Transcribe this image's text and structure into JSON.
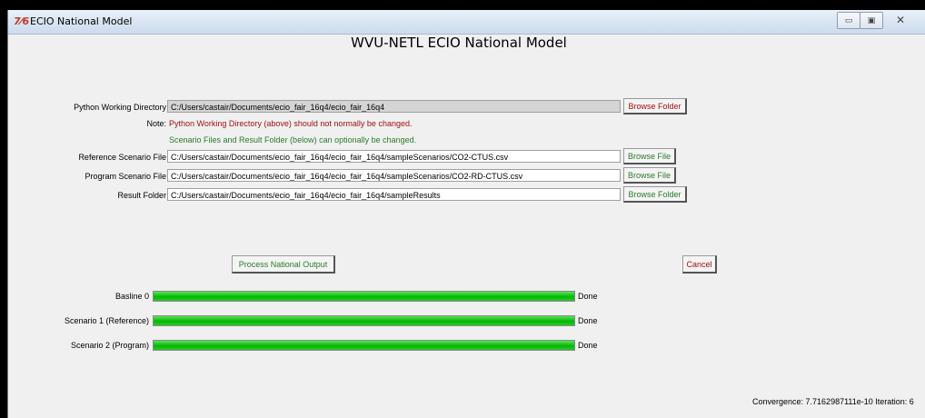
{
  "window": {
    "title": "ECIO National Model",
    "icon": "tk-feather-icon",
    "controls": {
      "minimize": "▭",
      "maximize": "▣",
      "close": "✕"
    }
  },
  "heading": "WVU-NETL ECIO National Model",
  "python_dir": {
    "label": "Python Working Directory",
    "value": "C:/Users/castair/Documents/ecio_fair_16q4/ecio_fair_16q4",
    "button": "Browse Folder"
  },
  "notes": {
    "label": "Note:",
    "line1": "Python Working Directory (above) should not normally be changed.",
    "line2": "Scenario Files and Result Folder (below) can optionally be changed."
  },
  "reference_file": {
    "label": "Reference Scenario File",
    "value": "C:/Users/castair/Documents/ecio_fair_16q4/ecio_fair_16q4/sampleScenarios/CO2-CTUS.csv",
    "button": "Browse File"
  },
  "program_file": {
    "label": "Program Scenario File",
    "value": "C:/Users/castair/Documents/ecio_fair_16q4/ecio_fair_16q4/sampleScenarios/CO2-RD-CTUS.csv",
    "button": "Browse File"
  },
  "result_folder": {
    "label": "Result Folder",
    "value": "C:/Users/castair/Documents/ecio_fair_16q4/ecio_fair_16q4/sampleResults",
    "button": "Browse Folder"
  },
  "actions": {
    "process": "Process National Output",
    "cancel": "Cancel"
  },
  "progress": [
    {
      "label": "Basline 0",
      "status": "Done",
      "fraction": 1.0
    },
    {
      "label": "Scenario 1 (Reference)",
      "status": "Done",
      "fraction": 1.0
    },
    {
      "label": "Scenario 2 (Program)",
      "status": "Done",
      "fraction": 1.0
    }
  ],
  "footer": {
    "convergence": "Convergence: 7.7162987111e-10  Iteration: 6"
  },
  "colors": {
    "progress_green": "#0fc40f",
    "warning_red": "#a01010",
    "info_green": "#2a7a2a"
  }
}
